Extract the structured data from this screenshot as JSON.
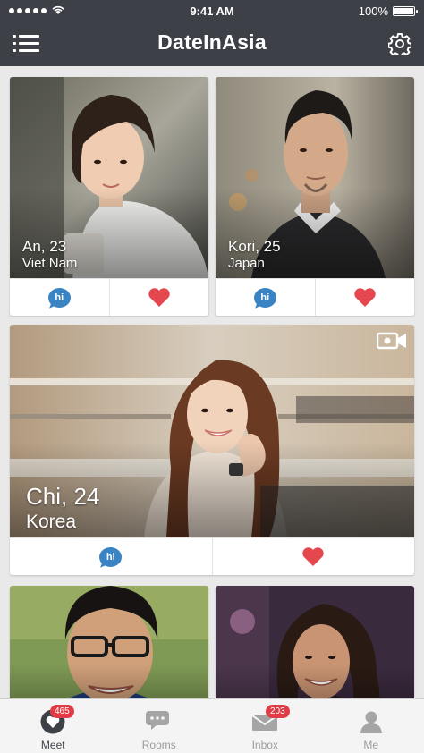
{
  "status_bar": {
    "time": "9:41 AM",
    "battery": "100%",
    "battery_level": 1.0
  },
  "header": {
    "title": "DateInAsia"
  },
  "profiles": [
    {
      "name_age": "An, 23",
      "country": "Viet Nam",
      "hi_label": "hi"
    },
    {
      "name_age": "Kori, 25",
      "country": "Japan",
      "hi_label": "hi"
    },
    {
      "name_age": "Chi, 24",
      "country": "Korea",
      "hi_label": "hi",
      "has_video": true
    },
    {
      "name_age": "",
      "country": ""
    },
    {
      "name_age": "",
      "country": ""
    }
  ],
  "tabs": [
    {
      "label": "Meet",
      "badge": "465",
      "icon": "heart-icon",
      "active": true
    },
    {
      "label": "Rooms",
      "badge": "",
      "icon": "chat-bubbles-icon"
    },
    {
      "label": "Inbox",
      "badge": "203",
      "icon": "envelope-icon"
    },
    {
      "label": "Me",
      "badge": "",
      "icon": "person-icon"
    }
  ],
  "colors": {
    "header_bg": "#3d4147",
    "hi_blue": "#3a84c4",
    "heart_red": "#e5474f",
    "badge_red": "#e23b45"
  }
}
